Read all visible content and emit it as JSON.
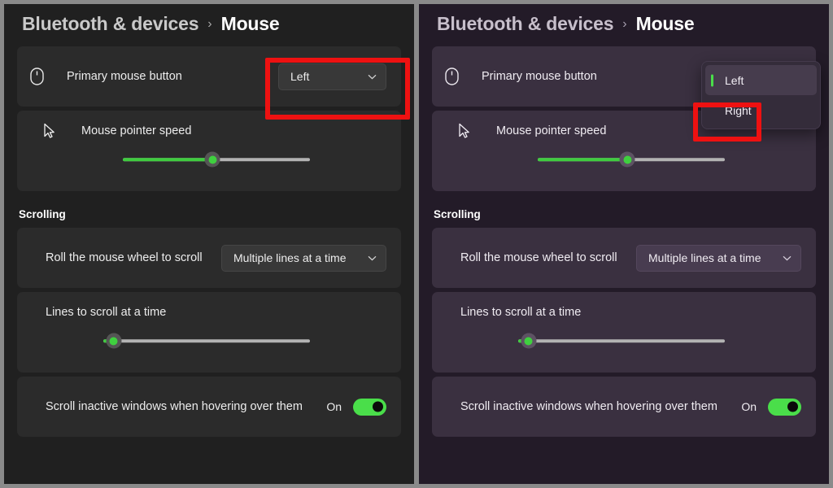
{
  "panels": [
    {
      "theme": "dark-neutral",
      "header": {
        "breadcrumb_root": "Bluetooth & devices",
        "breadcrumb_separator": "›",
        "breadcrumb_leaf": "Mouse"
      },
      "primary_button_row": {
        "icon": "mouse-icon",
        "label": "Primary mouse button",
        "dropdown_value": "Left",
        "chevron": "⌄"
      },
      "pointer_speed": {
        "icon": "cursor-arrow-icon",
        "label": "Mouse pointer speed",
        "value_percent": 48
      },
      "scrolling_section": {
        "heading": "Scrolling",
        "wheel_row": {
          "label": "Roll the mouse wheel to scroll",
          "dropdown_value": "Multiple lines at a time",
          "chevron": "⌄"
        },
        "lines_row": {
          "label": "Lines to scroll at a time",
          "value_percent": 5
        },
        "inactive_row": {
          "label": "Scroll inactive windows when hovering over them",
          "toggle_state": "On",
          "toggle_on": true
        }
      },
      "annotation": {
        "type": "red-highlight-box",
        "target": "primary-mouse-button-dropdown"
      }
    },
    {
      "theme": "dark-purple",
      "header": {
        "breadcrumb_root": "Bluetooth & devices",
        "breadcrumb_separator": "›",
        "breadcrumb_leaf": "Mouse"
      },
      "primary_button_row": {
        "icon": "mouse-icon",
        "label": "Primary mouse button",
        "dropdown_open": true,
        "options": [
          {
            "label": "Left",
            "selected": true
          },
          {
            "label": "Right",
            "selected": false
          }
        ]
      },
      "pointer_speed": {
        "icon": "cursor-arrow-icon",
        "label": "Mouse pointer speed",
        "value_percent": 48
      },
      "scrolling_section": {
        "heading": "Scrolling",
        "wheel_row": {
          "label": "Roll the mouse wheel to scroll",
          "dropdown_value": "Multiple lines at a time",
          "chevron": "⌄"
        },
        "lines_row": {
          "label": "Lines to scroll at a time",
          "value_percent": 5
        },
        "inactive_row": {
          "label": "Scroll inactive windows when hovering over them",
          "toggle_state": "On",
          "toggle_on": true
        }
      },
      "annotation": {
        "type": "red-highlight-box",
        "target": "dropdown-option-right"
      }
    }
  ],
  "colors": {
    "accent_green": "#4ade4a",
    "annotation_red": "#ee1111",
    "left_background": "#202020",
    "left_card": "#2b2b2b",
    "right_background": "#231b28",
    "right_card": "#3a3040",
    "frame_gray": "#8a8a8a"
  }
}
